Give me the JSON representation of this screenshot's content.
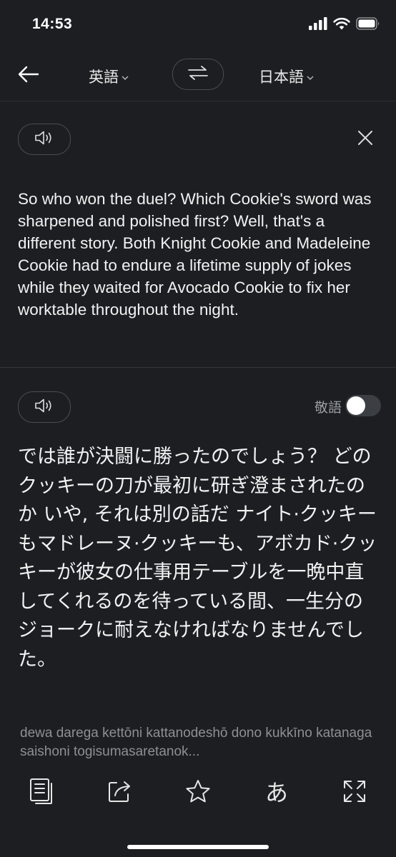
{
  "status_bar": {
    "time": "14:53"
  },
  "header": {
    "source_language": "英語",
    "target_language": "日本語"
  },
  "source": {
    "text": "So who won the duel? Which Cookie's sword was sharpened and polished first? Well, that's a different story. Both Knight Cookie and Madeleine Cookie had to endure a lifetime supply of jokes while they waited for Avocado Cookie to fix her worktable throughout the night."
  },
  "target": {
    "honorific_label": "敬語",
    "honorific_enabled": false,
    "text": "では誰が決闘に勝ったのでしょう？ どのクッキーの刀が最初に研ぎ澄まされたのか いや, それは別の話だ ナイト·クッキーもマドレーヌ·クッキーも、アボカド·クッキーが彼女の仕事用テーブルを一晩中直してくれるのを待っている間、一生分のジョークに耐えなければなりませんでした。",
    "romanization": "dewa darega kettōni kattanodeshō dono kukkīno katanaga saishoni togisumasaretanok..."
  },
  "toolbar": {
    "kana_label": "あ"
  },
  "colors": {
    "background": "#1c1e21",
    "text": "#f2f2f2",
    "muted": "#8c8f94",
    "border": "#4a4d52"
  }
}
